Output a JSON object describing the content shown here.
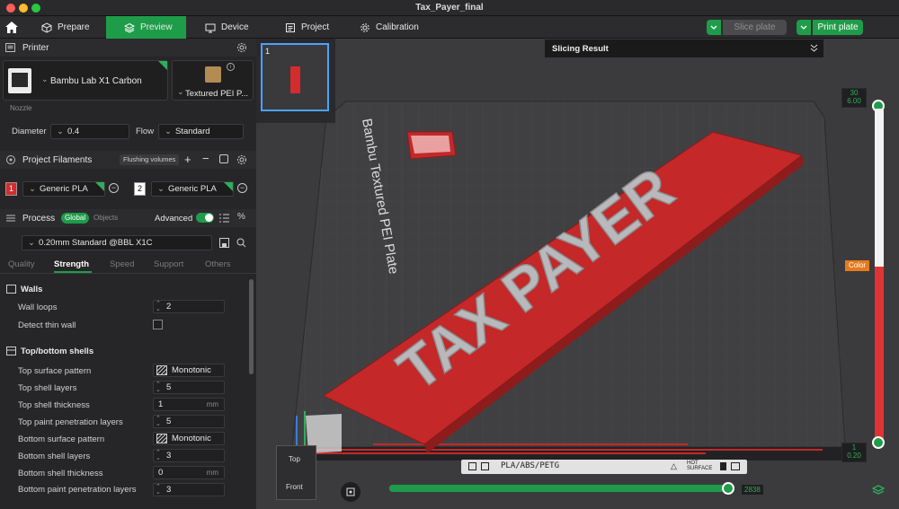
{
  "window": {
    "title": "Tax_Payer_final"
  },
  "toolbar": {
    "tabs": [
      {
        "label": "Prepare",
        "icon": "cube-icon"
      },
      {
        "label": "Preview",
        "icon": "layers-icon"
      },
      {
        "label": "Device",
        "icon": "monitor-icon"
      },
      {
        "label": "Project",
        "icon": "document-icon"
      },
      {
        "label": "Calibration",
        "icon": "gear-icon"
      }
    ],
    "slice_label": "Slice plate",
    "print_label": "Print plate"
  },
  "printer": {
    "section_title": "Printer",
    "name": "Bambu Lab X1 Carbon",
    "plate": "Textured PEI P...",
    "nozzle_label": "Nozzle",
    "diameter_label": "Diameter",
    "diameter_value": "0.4",
    "flow_label": "Flow",
    "flow_value": "Standard"
  },
  "filaments": {
    "section_title": "Project Filaments",
    "flushing_label": "Flushing volumes",
    "items": [
      {
        "index": "1",
        "name": "Generic PLA",
        "color": "#d42c2c"
      },
      {
        "index": "2",
        "name": "Generic PLA",
        "color": "#ffffff"
      }
    ]
  },
  "process": {
    "section_title": "Process",
    "global_label": "Global",
    "objects_label": "Objects",
    "advanced_label": "Advanced",
    "advanced_on": true,
    "preset": "0.20mm Standard @BBL X1C",
    "tabs": [
      "Quality",
      "Strength",
      "Speed",
      "Support",
      "Others"
    ],
    "active_tab": "Strength"
  },
  "walls": {
    "title": "Walls",
    "wall_loops_label": "Wall loops",
    "wall_loops_value": "2",
    "detect_thin_label": "Detect thin wall"
  },
  "shells": {
    "title": "Top/bottom shells",
    "rows": [
      {
        "label": "Top surface pattern",
        "value": "Monotonic",
        "kind": "pattern"
      },
      {
        "label": "Top shell layers",
        "value": "5",
        "kind": "stepper"
      },
      {
        "label": "Top shell thickness",
        "value": "1",
        "unit": "mm",
        "kind": "unit"
      },
      {
        "label": "Top paint penetration layers",
        "value": "5",
        "kind": "stepper"
      },
      {
        "label": "Bottom surface pattern",
        "value": "Monotonic",
        "kind": "pattern"
      },
      {
        "label": "Bottom shell layers",
        "value": "3",
        "kind": "stepper"
      },
      {
        "label": "Bottom shell thickness",
        "value": "0",
        "unit": "mm",
        "kind": "unit"
      },
      {
        "label": "Bottom paint penetration layers",
        "value": "3",
        "kind": "stepper"
      }
    ]
  },
  "viewport": {
    "plate_number": "1",
    "slicing_result_label": "Slicing Result",
    "plate_text": "Bambu Textured PEI Plate",
    "model_text": "TAX PAYER",
    "bed_label": "PLA/ABS/PETG",
    "hot_surface_label": "HOT SURFACE",
    "layer_top_value": "30",
    "layer_top_time": "6.00",
    "layer_bottom_value": "1",
    "layer_bottom_height": "0.20",
    "color_label": "Color",
    "progress_value": "2838",
    "view_top_label": "Top",
    "view_front_label": "Front",
    "progress_fraction": 1.0
  }
}
